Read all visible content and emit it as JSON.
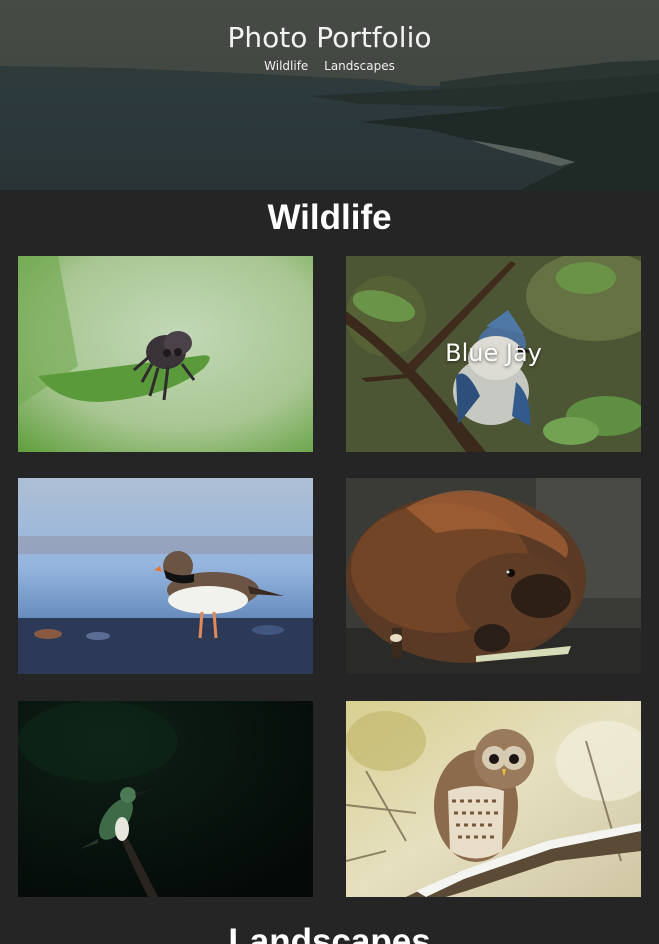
{
  "hero": {
    "title": "Photo Portfolio",
    "nav": [
      {
        "label": "Wildlife"
      },
      {
        "label": "Landscapes"
      }
    ]
  },
  "sections": [
    {
      "title": "Wildlife",
      "photos": [
        {
          "subject": "jumping spider",
          "caption": ""
        },
        {
          "subject": "blue jay",
          "caption": "Blue Jay"
        },
        {
          "subject": "plover",
          "caption": ""
        },
        {
          "subject": "beaver",
          "caption": ""
        },
        {
          "subject": "hummingbird",
          "caption": ""
        },
        {
          "subject": "barred owl",
          "caption": ""
        }
      ]
    },
    {
      "title": "Landscapes"
    }
  ],
  "colors": {
    "background": "#252525",
    "text": "#ffffff"
  }
}
